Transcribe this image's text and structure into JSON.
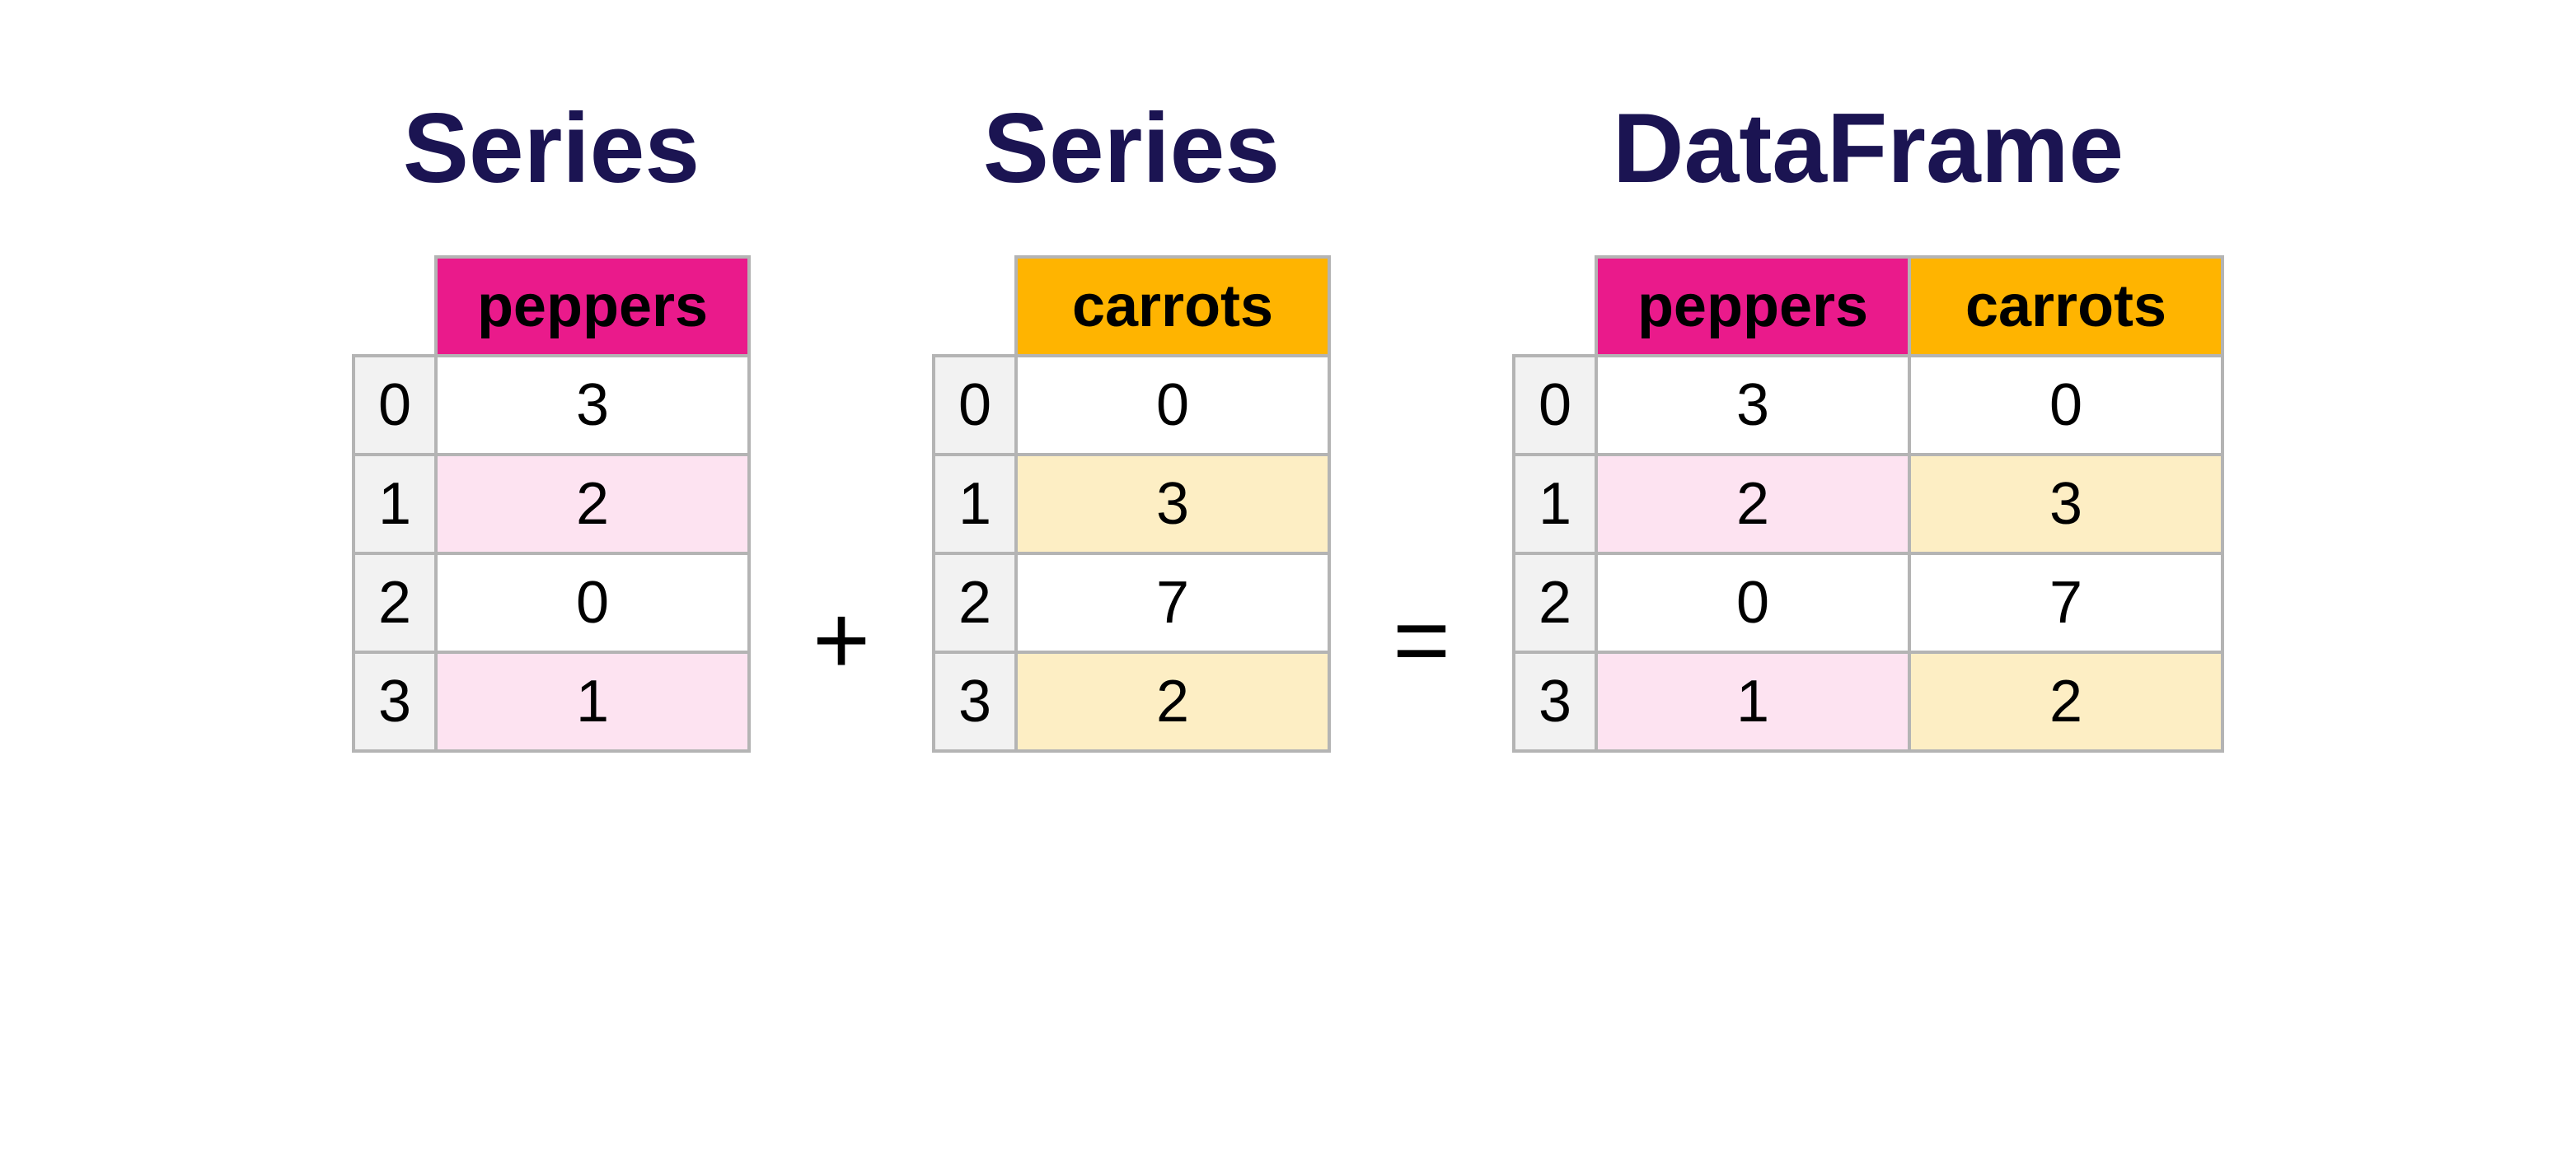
{
  "titles": {
    "series1": "Series",
    "series2": "Series",
    "dataframe": "DataFrame"
  },
  "operators": {
    "plus": "+",
    "equals": "="
  },
  "columns": {
    "peppers": "peppers",
    "carrots": "carrots"
  },
  "index": [
    "0",
    "1",
    "2",
    "3"
  ],
  "series_peppers": {
    "values": [
      "3",
      "2",
      "0",
      "1"
    ]
  },
  "series_carrots": {
    "values": [
      "0",
      "3",
      "7",
      "2"
    ]
  },
  "dataframe": {
    "peppers": [
      "3",
      "2",
      "0",
      "1"
    ],
    "carrots": [
      "0",
      "3",
      "7",
      "2"
    ]
  },
  "colors": {
    "title": "#1b1452",
    "peppers_header": "#ea1a8b",
    "peppers_alt": "#fde3f1",
    "carrots_header": "#ffb400",
    "carrots_alt": "#fdeec4",
    "index_bg": "#f2f2f2",
    "grid": "#b4b4b4"
  }
}
